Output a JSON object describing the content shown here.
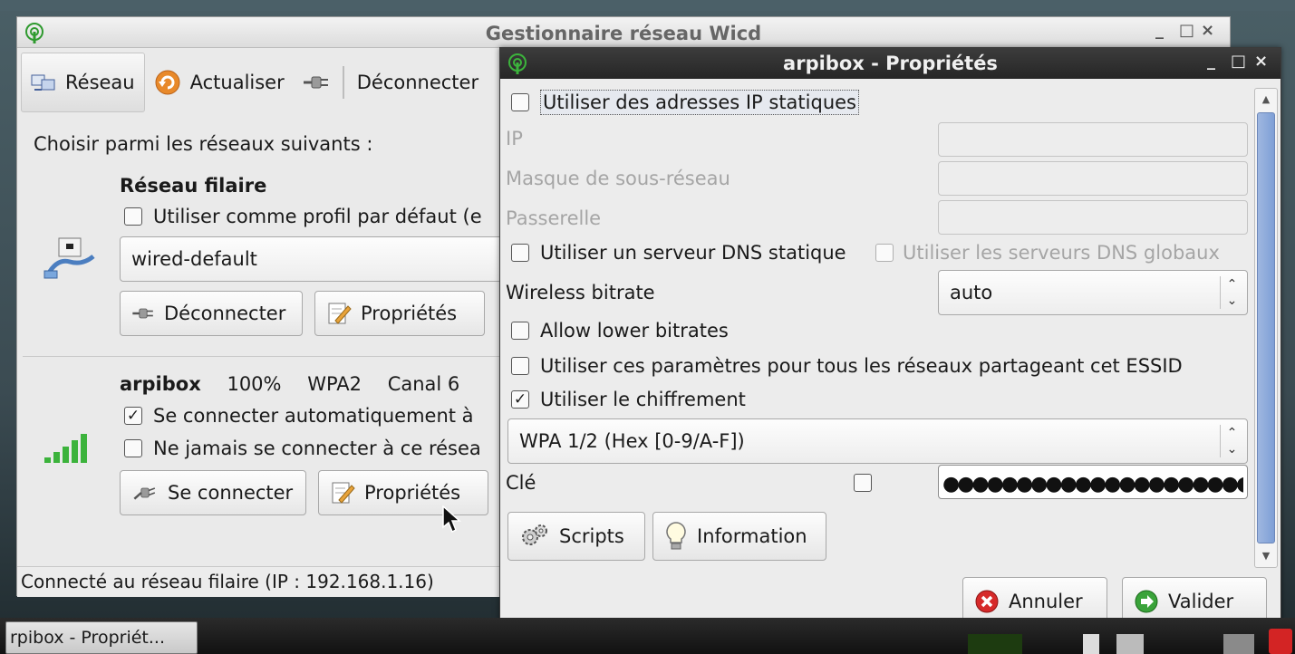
{
  "colors": {
    "accent_blue": "#7e9fd6",
    "signal_green": "#3cb33c",
    "cancel_red": "#d62a2a",
    "ok_green": "#3aa33a",
    "refresh_orange": "#e8892a"
  },
  "main_window": {
    "title": "Gestionnaire réseau Wicd",
    "controls": [
      "_",
      "□",
      "×"
    ],
    "toolbar": {
      "network": "Réseau",
      "refresh": "Actualiser",
      "disconnect": "Déconnecter"
    },
    "choose_label": "Choisir parmi les réseaux suivants :",
    "wired": {
      "title": "Réseau filaire",
      "default_profile_label": "Utiliser comme profil par défaut (e",
      "profile": "wired-default",
      "disconnect_button": "Déconnecter",
      "properties_button": "Propriétés"
    },
    "wireless": {
      "essid": "arpibox",
      "quality": "100%",
      "encryption": "WPA2",
      "channel": "Canal 6",
      "auto_connect_label": "Se connecter automatiquement à",
      "auto_connect_checked": true,
      "never_connect_label": "Ne jamais se connecter à ce résea",
      "never_connect_checked": false,
      "connect_button": "Se connecter",
      "properties_button": "Propriétés",
      "signal_level": 1.0
    },
    "status": "Connecté au réseau filaire (IP : 192.168.1.16)"
  },
  "dialog": {
    "title": "arpibox - Propriétés",
    "controls": [
      "_",
      "□",
      "×"
    ],
    "static_ip_label": "Utiliser des adresses IP statiques",
    "static_ip_checked": false,
    "ip_label": "IP",
    "netmask_label": "Masque de sous-réseau",
    "gateway_label": "Passerelle",
    "static_dns_label": "Utiliser un serveur DNS statique",
    "static_dns_checked": false,
    "global_dns_label": "Utiliser les serveurs DNS globaux",
    "global_dns_checked": false,
    "bitrate_label": "Wireless bitrate",
    "bitrate_value": "auto",
    "lower_bitrates_label": "Allow lower bitrates",
    "lower_bitrates_checked": false,
    "essid_settings_label": "Utiliser ces paramètres pour tous les réseaux partageant cet ESSID",
    "essid_settings_checked": false,
    "encryption_label": "Utiliser le chiffrement",
    "encryption_checked": true,
    "encryption_type": "WPA 1/2 (Hex [0-9/A-F])",
    "key_label": "Clé",
    "key_value": "●●●●●●●●●●●●●●●●●●●●●●●●●●●●●●●●",
    "show_key_checked": false,
    "scripts_button": "Scripts",
    "information_button": "Information",
    "cancel_button": "Annuler",
    "ok_button": "Valider"
  },
  "taskbar": {
    "active_task": "rpibox - Propriét..."
  }
}
